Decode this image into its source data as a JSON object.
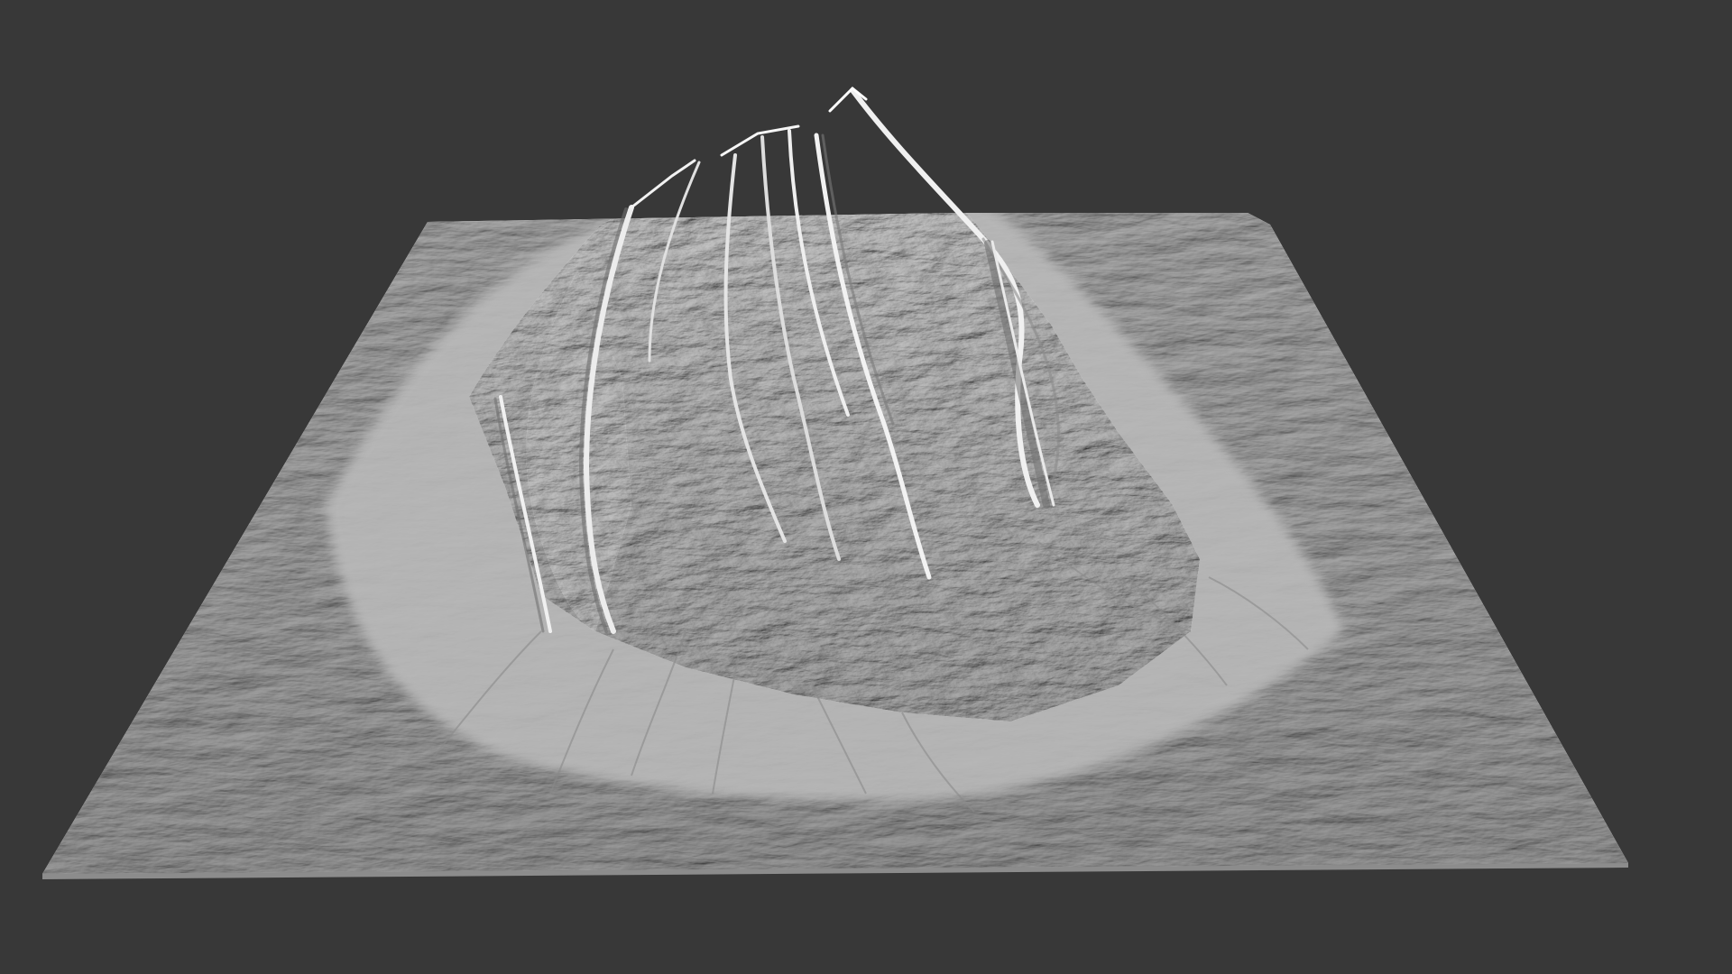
{
  "viewport": {
    "background_color": "#383838",
    "mesh_color": "#bdbdbd",
    "mesh_highlight_color": "#e2e2e2",
    "mesh_shadow_color": "#7d7d7d",
    "object": "terrain-heightmap-mesh",
    "shading": "matcap-gray"
  }
}
